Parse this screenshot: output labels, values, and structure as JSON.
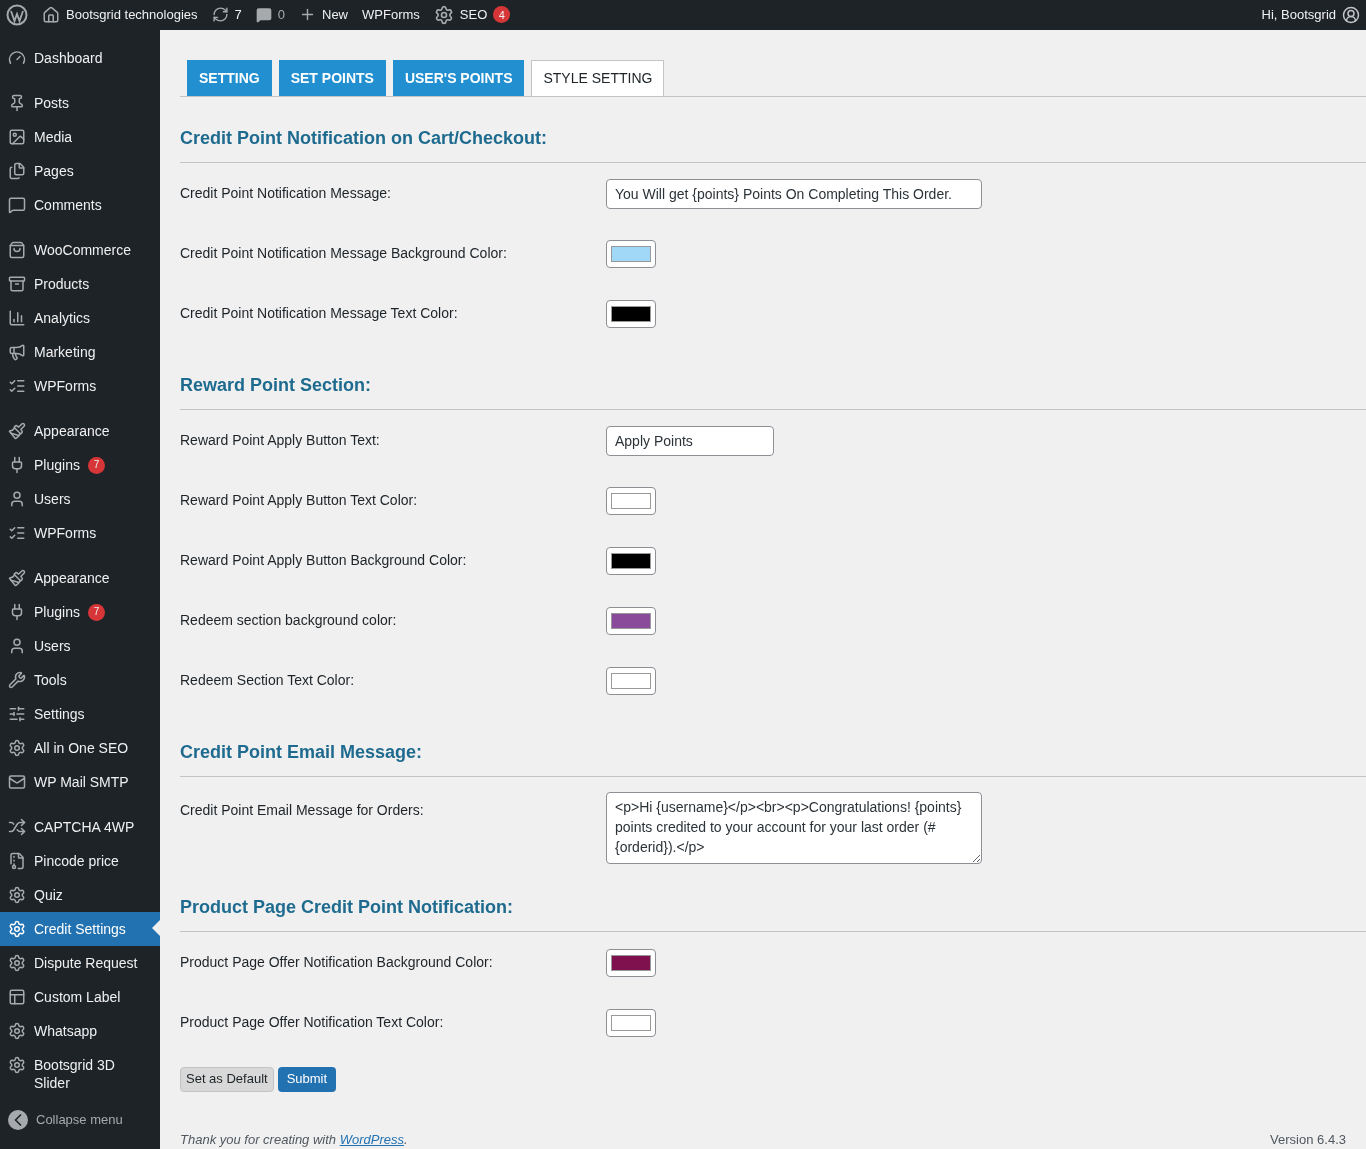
{
  "admin_bar": {
    "site": "Bootsgrid technologies",
    "updates": "7",
    "comments": "0",
    "new": "New",
    "wpforms": "WPForms",
    "seo": "SEO",
    "seo_badge": "4",
    "greeting": "Hi, Bootsgrid"
  },
  "sidebar": {
    "groups": [
      [
        {
          "label": "Dashboard",
          "selected": false
        }
      ],
      [
        {
          "label": "Posts",
          "selected": false
        },
        {
          "label": "Media",
          "selected": false
        },
        {
          "label": "Pages",
          "selected": false
        },
        {
          "label": "Comments",
          "selected": false
        }
      ],
      [
        {
          "label": "WooCommerce",
          "selected": false
        },
        {
          "label": "Products",
          "selected": false
        },
        {
          "label": "Analytics",
          "selected": false
        },
        {
          "label": "Marketing",
          "selected": false
        },
        {
          "label": "WPForms",
          "selected": false
        }
      ],
      [
        {
          "label": "Appearance",
          "selected": false
        },
        {
          "label": "Plugins",
          "badge": "7",
          "selected": false
        },
        {
          "label": "Users",
          "selected": false
        },
        {
          "label": "WPForms",
          "selected": false
        }
      ],
      [
        {
          "label": "Appearance",
          "selected": false
        },
        {
          "label": "Plugins",
          "badge": "7",
          "selected": false
        },
        {
          "label": "Users",
          "selected": false
        },
        {
          "label": "Tools",
          "selected": false
        },
        {
          "label": "Settings",
          "selected": false
        },
        {
          "label": "All in One SEO",
          "selected": false
        },
        {
          "label": "WP Mail SMTP",
          "selected": false
        }
      ],
      [
        {
          "label": "CAPTCHA 4WP",
          "selected": false
        },
        {
          "label": "Pincode price",
          "selected": false
        },
        {
          "label": "Quiz",
          "selected": false
        },
        {
          "label": "Credit Settings",
          "selected": true
        },
        {
          "label": "Dispute Request",
          "selected": false
        },
        {
          "label": "Custom Label",
          "selected": false
        },
        {
          "label": "Whatsapp",
          "selected": false
        },
        {
          "label": "Bootsgrid 3D Slider",
          "selected": false
        }
      ]
    ],
    "collapse": "Collapse menu"
  },
  "tabs": [
    {
      "label": "SETTING",
      "selected": false
    },
    {
      "label": "SET POINTS",
      "selected": false
    },
    {
      "label": "USER'S POINTS",
      "selected": false
    },
    {
      "label": "STYLE SETTING",
      "selected": true
    }
  ],
  "sections": [
    {
      "title": "Credit Point Notification on Cart/Checkout:",
      "rows": [
        {
          "kind": "text",
          "label": "Credit Point Notification Message:",
          "value": "You Will get {points} Points On Completing This Order."
        },
        {
          "kind": "color",
          "label": "Credit Point Notification Message Background Color:",
          "color": "#a1d8f7"
        },
        {
          "kind": "color",
          "label": "Credit Point Notification Message Text Color:",
          "color": "#000000"
        }
      ]
    },
    {
      "title": "Reward Point Section:",
      "rows": [
        {
          "kind": "short_text",
          "label": "Reward Point Apply Button Text:",
          "value": "Apply Points"
        },
        {
          "kind": "color",
          "label": "Reward Point Apply Button Text Color:",
          "color": "#ffffff"
        },
        {
          "kind": "color",
          "label": "Reward Point Apply Button Background Color:",
          "color": "#000000"
        },
        {
          "kind": "color",
          "label": "Redeem section background color:",
          "color": "#8a4b9b"
        },
        {
          "kind": "color",
          "label": "Redeem Section Text Color:",
          "color": "#ffffff"
        }
      ]
    },
    {
      "title": "Credit Point Email Message:",
      "rows": [
        {
          "kind": "textarea",
          "label": "Credit Point Email Message for Orders:",
          "value": "<p>Hi {username}</p><br><p>Congratulations! {points} points credited to your account for your last order (#{orderid}).</p>"
        }
      ]
    },
    {
      "title": "Product Page Credit Point Notification:",
      "rows": [
        {
          "kind": "color",
          "label": "Product Page Offer Notification Background Color:",
          "color": "#80114f"
        },
        {
          "kind": "color",
          "label": "Product Page Offer Notification Text Color:",
          "color": "#ffffff"
        }
      ]
    }
  ],
  "buttons": {
    "default": "Set as Default",
    "submit": "Submit"
  },
  "footer": {
    "before": "Thank you for creating with ",
    "link": "WordPress",
    "after": ".",
    "version": "Version 6.4.3"
  }
}
